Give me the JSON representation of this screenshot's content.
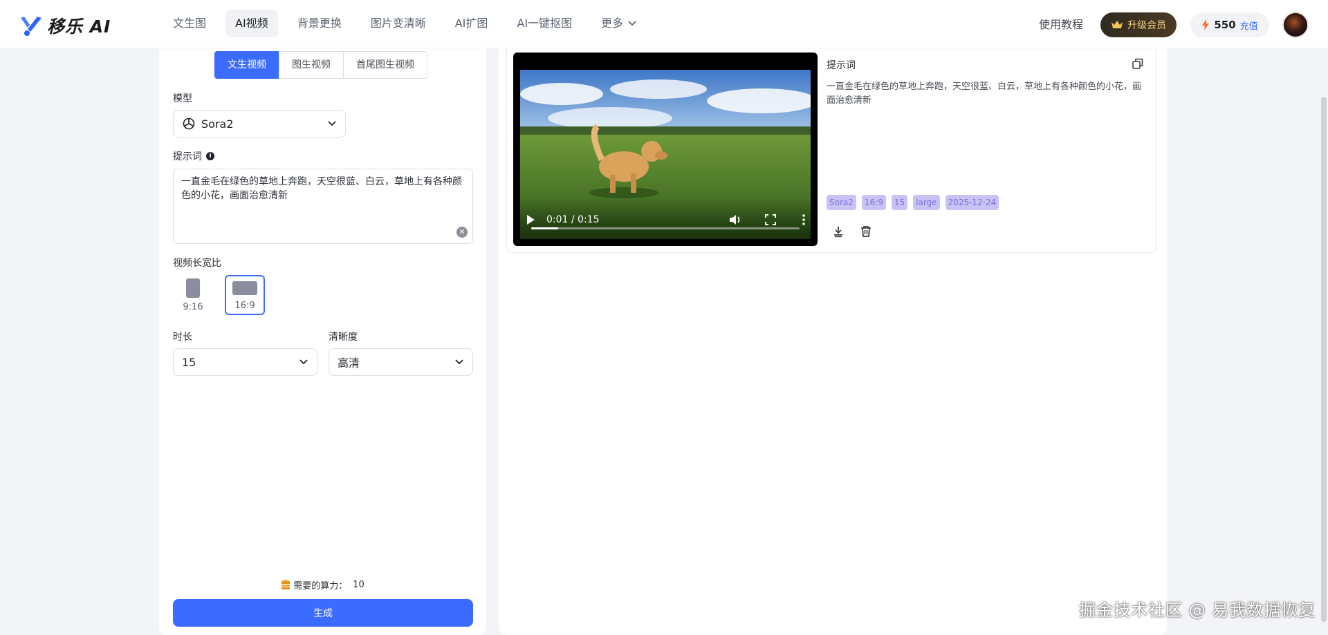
{
  "header": {
    "logo_text": "移乐 AI",
    "nav": [
      {
        "label": "文生图"
      },
      {
        "label": "AI视频",
        "active": true
      },
      {
        "label": "背景更换"
      },
      {
        "label": "图片变清晰"
      },
      {
        "label": "AI扩图"
      },
      {
        "label": "AI一键抠图"
      },
      {
        "label": "更多"
      }
    ],
    "tutorial": "使用教程",
    "vip_label": "升级会员",
    "points": "550",
    "recharge": "充值",
    "brand_color": "#3b6cff"
  },
  "left": {
    "tabs": [
      "文生视频",
      "图生视频",
      "首尾图生视频"
    ],
    "active_tab": "文生视频",
    "model_label": "模型",
    "model_value": "Sora2",
    "prompt_label": "提示词",
    "prompt_value": "一直金毛在绿色的草地上奔跑，天空很蓝、白云，草地上有各种颜色的小花，画面治愈清新",
    "ratio_label": "视频长宽比",
    "ratios": [
      {
        "label": "9:16",
        "selected": false
      },
      {
        "label": "16:9",
        "selected": true
      }
    ],
    "duration_label": "时长",
    "duration_value": "15",
    "quality_label": "清晰度",
    "quality_value": "高清",
    "cost_label": "需要的算力：",
    "cost_value": "10",
    "generate_label": "生成"
  },
  "result": {
    "video": {
      "time": "0:01 / 0:15",
      "progress": 0.1
    },
    "prompt_title": "提示词",
    "prompt_text": "一直金毛在绿色的草地上奔跑，天空很蓝、白云，草地上有各种颜色的小花，画面治愈清新",
    "tags": [
      "Sora2",
      "16:9",
      "15",
      "large",
      "2025-12-24"
    ]
  },
  "watermark": "掘金技术社区 @ 易我数据恢复"
}
